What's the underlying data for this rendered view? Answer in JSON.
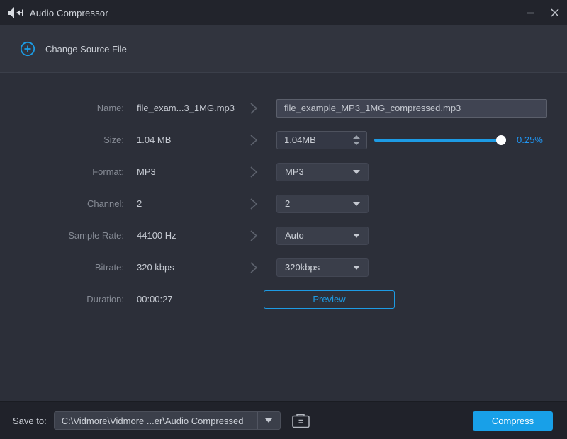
{
  "window": {
    "title": "Audio Compressor",
    "icon": "speaker-compress-icon"
  },
  "header": {
    "change_source_label": "Change Source File"
  },
  "form": {
    "rows": [
      {
        "label": "Name:",
        "value": "file_exam...3_1MG.mp3"
      },
      {
        "label": "Size:",
        "value": "1.04 MB"
      },
      {
        "label": "Format:",
        "value": "MP3"
      },
      {
        "label": "Channel:",
        "value": "2"
      },
      {
        "label": "Sample Rate:",
        "value": "44100 Hz"
      },
      {
        "label": "Bitrate:",
        "value": "320 kbps"
      },
      {
        "label": "Duration:",
        "value": "00:00:27"
      }
    ],
    "name_input": {
      "value": "file_example_MP3_1MG_compressed.mp3"
    },
    "size_input": {
      "value": "1.04MB",
      "percent_label": "0.25%",
      "slider_position": "right-end"
    },
    "format_dropdown": {
      "selected": "MP3"
    },
    "channel_dropdown": {
      "selected": "2"
    },
    "sample_rate_dropdown": {
      "selected": "Auto"
    },
    "bitrate_dropdown": {
      "selected": "320kbps"
    },
    "preview_button": {
      "label": "Preview"
    }
  },
  "footer": {
    "save_to_label": "Save to:",
    "save_path": "C:\\Vidmore\\Vidmore ...er\\Audio Compressed",
    "compress_label": "Compress"
  },
  "colors": {
    "accent_blue": "#1d9be4",
    "percent_blue": "#2196f3",
    "titlebar_bg": "#22242c",
    "header_bg": "#31343e",
    "main_bg": "#2c2f39",
    "footer_bg": "#20222a"
  }
}
